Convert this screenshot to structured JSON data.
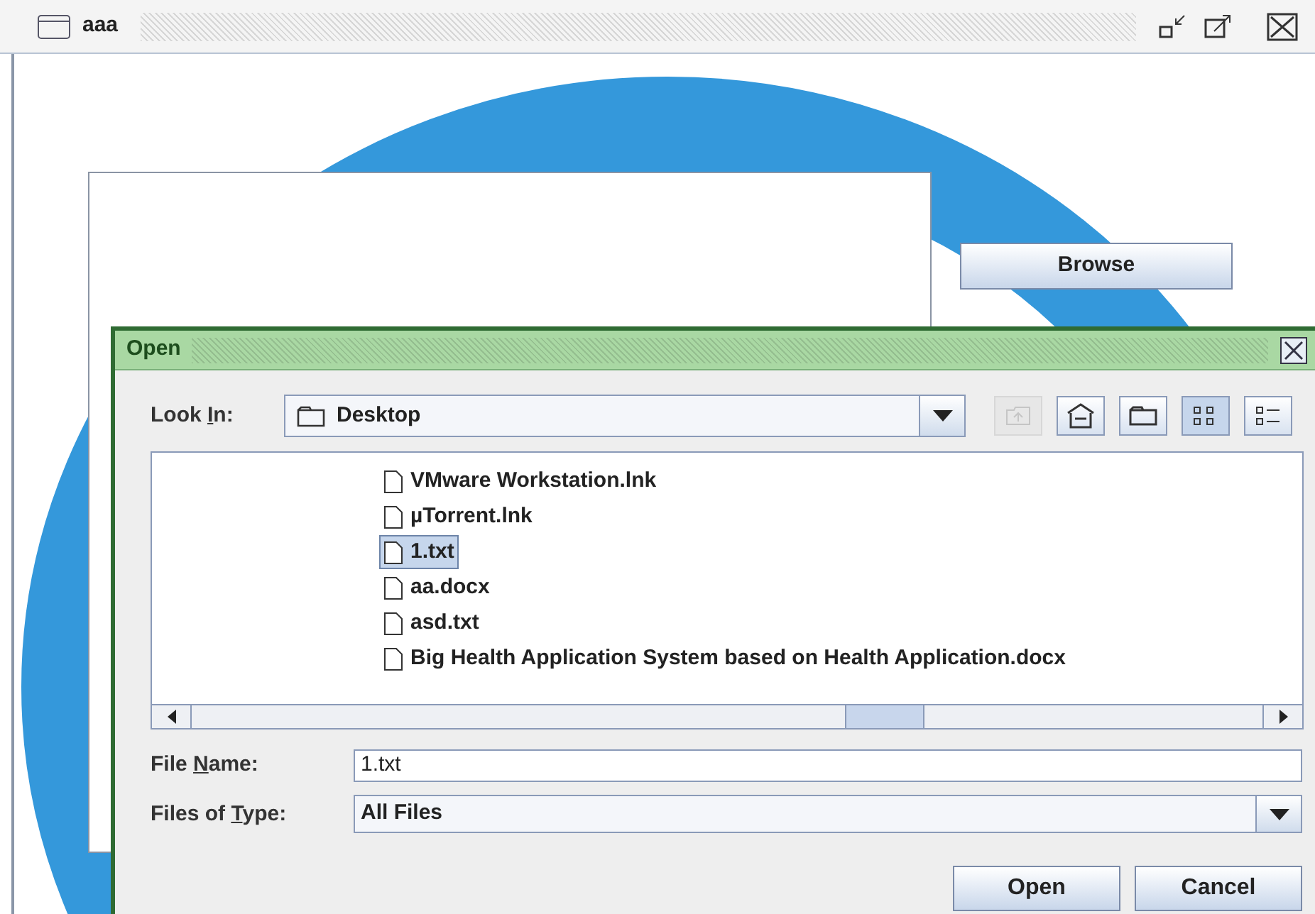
{
  "frame": {
    "title": "aaa"
  },
  "browse_button": "Browse",
  "dialog": {
    "title": "Open",
    "look_in": {
      "label_before": "Look ",
      "label_key": "I",
      "label_after": "n:",
      "value": "Desktop"
    },
    "toolbar": [
      {
        "kind": "up",
        "disabled": true,
        "selected": false
      },
      {
        "kind": "home",
        "disabled": false,
        "selected": false
      },
      {
        "kind": "newfolder",
        "disabled": false,
        "selected": false
      },
      {
        "kind": "list",
        "disabled": false,
        "selected": true
      },
      {
        "kind": "details",
        "disabled": false,
        "selected": false
      }
    ],
    "files": [
      {
        "name": "VMware Workstation.lnk",
        "selected": false
      },
      {
        "name": "µTorrent.lnk",
        "selected": false
      },
      {
        "name": "1.txt",
        "selected": true
      },
      {
        "name": "aa.docx",
        "selected": false
      },
      {
        "name": "asd.txt",
        "selected": false
      },
      {
        "name": "Big Health Application System based on Health Application.docx",
        "selected": false
      }
    ],
    "file_name": {
      "label_before": "File ",
      "label_key": "N",
      "label_after": "ame:",
      "value": "1.txt"
    },
    "file_type": {
      "label_before": "Files of ",
      "label_key": "T",
      "label_after": "ype:",
      "value": "All Files"
    },
    "buttons": [
      "Open",
      "Cancel"
    ]
  }
}
